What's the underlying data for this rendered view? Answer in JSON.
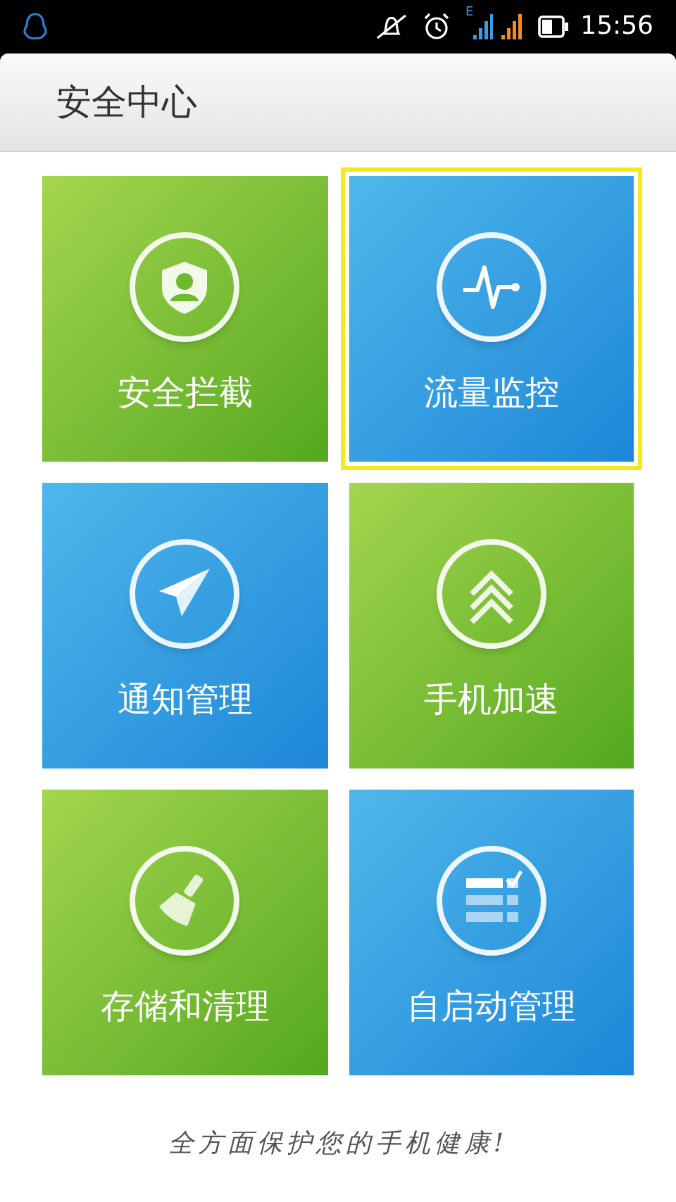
{
  "status_bar": {
    "time": "15:56",
    "network_type": "E"
  },
  "header": {
    "title": "安全中心"
  },
  "tiles": [
    {
      "label": "安全拦截",
      "kind": "green",
      "selected": false
    },
    {
      "label": "流量监控",
      "kind": "blue",
      "selected": true
    },
    {
      "label": "通知管理",
      "kind": "blue",
      "selected": false
    },
    {
      "label": "手机加速",
      "kind": "green",
      "selected": false
    },
    {
      "label": "存储和清理",
      "kind": "green",
      "selected": false
    },
    {
      "label": "自启动管理",
      "kind": "blue",
      "selected": false
    }
  ],
  "footer": {
    "slogan": "全方面保护您的手机健康!"
  }
}
